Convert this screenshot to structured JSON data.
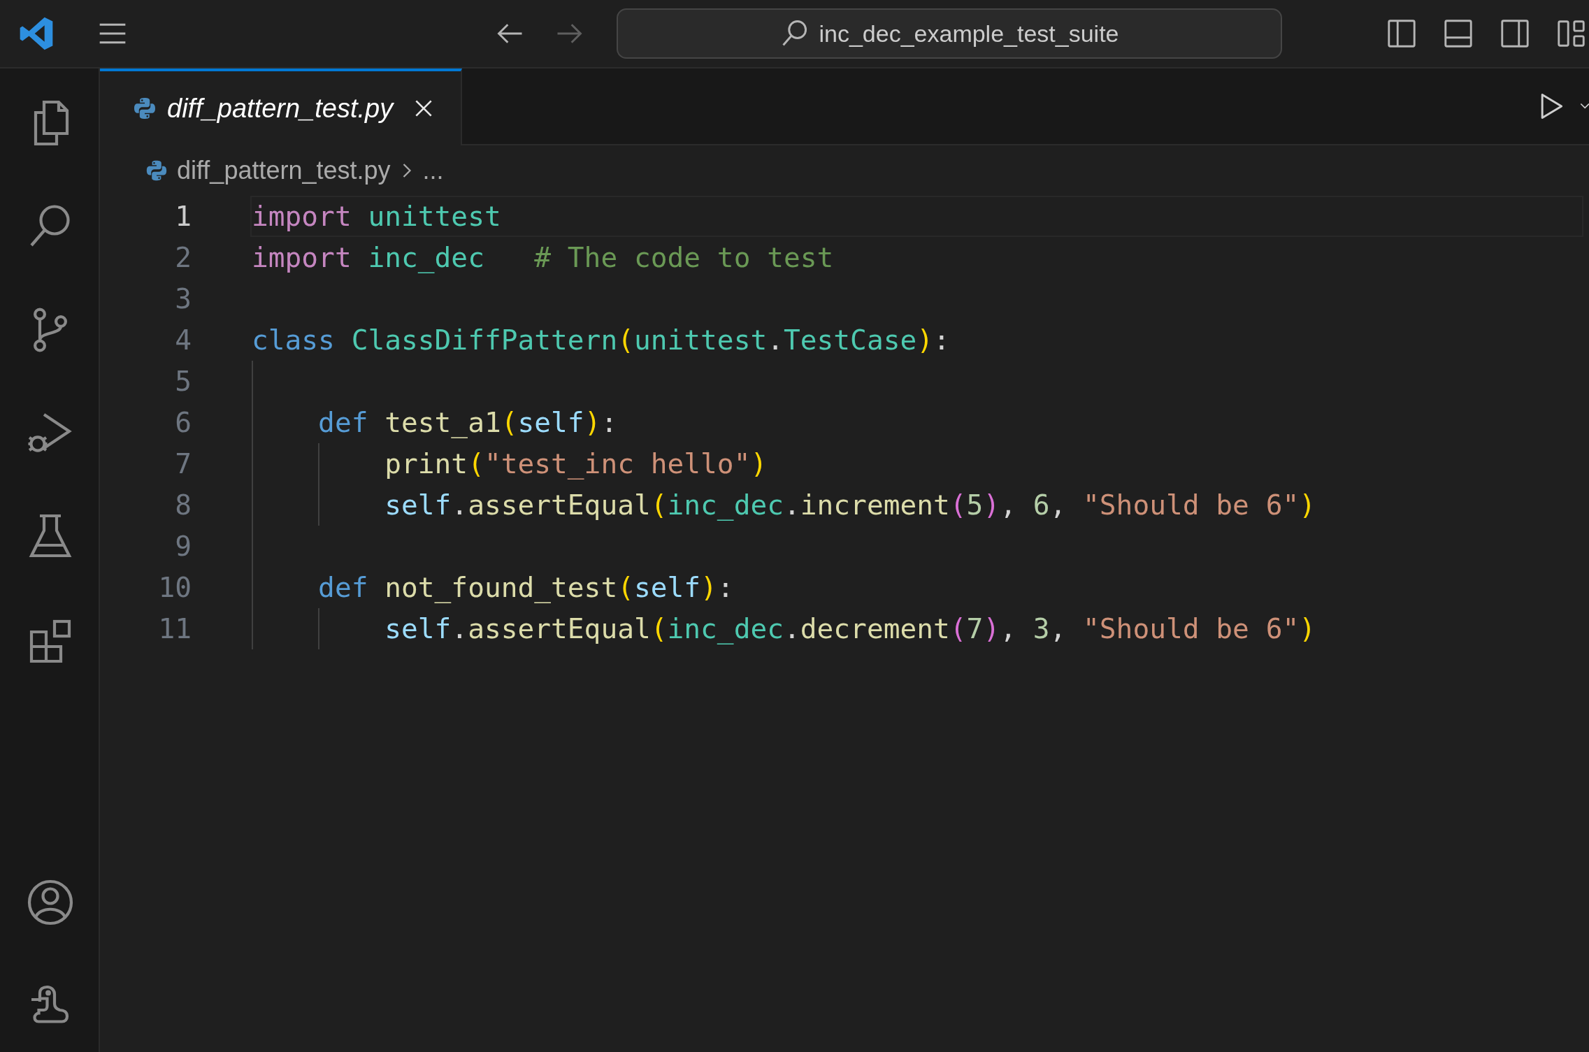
{
  "title_bar": {
    "nav": [
      {
        "kind": "back",
        "disabled": false
      },
      {
        "kind": "forward",
        "disabled": true
      }
    ],
    "command_center": {
      "label": "inc_dec_example_test_suite"
    }
  },
  "activity_bar": {
    "items": [
      {
        "kind": "explorer",
        "selected": false
      },
      {
        "kind": "search",
        "selected": false
      },
      {
        "kind": "source_control",
        "selected": false
      },
      {
        "kind": "run_debug",
        "selected": false
      },
      {
        "kind": "testing",
        "selected": false
      },
      {
        "kind": "extensions",
        "selected": false
      }
    ],
    "bottom_items": [
      {
        "kind": "account"
      },
      {
        "kind": "python_env"
      }
    ]
  },
  "tabs": [
    {
      "label": "diff_pattern_test.py",
      "selected": true,
      "preview": true
    }
  ],
  "breadcrumb": [
    "diff_pattern_test.py",
    "..."
  ],
  "editor": {
    "lines": [
      {
        "number": "1",
        "current": true,
        "tokens": [
          {
            "text": "import",
            "kind": "keyword"
          },
          {
            "text": " unittest",
            "kind": "module"
          }
        ]
      },
      {
        "number": "2",
        "current": false,
        "tokens": [
          {
            "text": "import",
            "kind": "keyword"
          },
          {
            "text": " inc_dec",
            "kind": "module"
          },
          {
            "text": "   # The code to test",
            "kind": "comment"
          }
        ]
      },
      {
        "number": "3",
        "current": false
      },
      {
        "number": "4",
        "current": false,
        "tokens": [
          {
            "text": "class",
            "kind": "storage"
          },
          {
            "text": " ClassDiffPattern",
            "kind": "class"
          },
          {
            "text": "(",
            "kind": "paren1"
          },
          {
            "text": "unittest",
            "kind": "module"
          },
          {
            "text": ".",
            "kind": "plain"
          },
          {
            "text": "TestCase",
            "kind": "class"
          },
          {
            "text": ")",
            "kind": "paren1"
          },
          {
            "text": ":",
            "kind": "plain"
          }
        ]
      },
      {
        "number": "5",
        "current": false
      },
      {
        "number": "6",
        "current": false,
        "tokens": [
          {
            "text": "    def",
            "kind": "storage"
          },
          {
            "text": " test_a1",
            "kind": "func"
          },
          {
            "text": "(",
            "kind": "paren1"
          },
          {
            "text": "self",
            "kind": "param"
          },
          {
            "text": ")",
            "kind": "paren1"
          },
          {
            "text": ":",
            "kind": "plain"
          }
        ]
      },
      {
        "number": "7",
        "current": false,
        "tokens": [
          {
            "text": "        print",
            "kind": "func"
          },
          {
            "text": "(",
            "kind": "paren1"
          },
          {
            "text": "\"test_inc hello\"",
            "kind": "string"
          },
          {
            "text": ")",
            "kind": "paren1"
          }
        ]
      },
      {
        "number": "8",
        "current": false,
        "tokens": [
          {
            "text": "        self",
            "kind": "param"
          },
          {
            "text": ".",
            "kind": "plain"
          },
          {
            "text": "assertEqual",
            "kind": "func"
          },
          {
            "text": "(",
            "kind": "paren1"
          },
          {
            "text": "inc_dec",
            "kind": "module"
          },
          {
            "text": ".",
            "kind": "plain"
          },
          {
            "text": "increment",
            "kind": "func"
          },
          {
            "text": "(",
            "kind": "paren2"
          },
          {
            "text": "5",
            "kind": "number"
          },
          {
            "text": ")",
            "kind": "paren2"
          },
          {
            "text": ", ",
            "kind": "plain"
          },
          {
            "text": "6",
            "kind": "number"
          },
          {
            "text": ", ",
            "kind": "plain"
          },
          {
            "text": "\"Should be 6\"",
            "kind": "string"
          },
          {
            "text": ")",
            "kind": "paren1"
          }
        ]
      },
      {
        "number": "9",
        "current": false
      },
      {
        "number": "10",
        "current": false,
        "tokens": [
          {
            "text": "    def",
            "kind": "storage"
          },
          {
            "text": " not_found_test",
            "kind": "func"
          },
          {
            "text": "(",
            "kind": "paren1"
          },
          {
            "text": "self",
            "kind": "param"
          },
          {
            "text": ")",
            "kind": "paren1"
          },
          {
            "text": ":",
            "kind": "plain"
          }
        ]
      },
      {
        "number": "11",
        "current": false,
        "tokens": [
          {
            "text": "        self",
            "kind": "param"
          },
          {
            "text": ".",
            "kind": "plain"
          },
          {
            "text": "assertEqual",
            "kind": "func"
          },
          {
            "text": "(",
            "kind": "paren1"
          },
          {
            "text": "inc_dec",
            "kind": "module"
          },
          {
            "text": ".",
            "kind": "plain"
          },
          {
            "text": "decrement",
            "kind": "func"
          },
          {
            "text": "(",
            "kind": "paren2"
          },
          {
            "text": "7",
            "kind": "number"
          },
          {
            "text": ")",
            "kind": "paren2"
          },
          {
            "text": ", ",
            "kind": "plain"
          },
          {
            "text": "3",
            "kind": "number"
          },
          {
            "text": ", ",
            "kind": "plain"
          },
          {
            "text": "\"Should be 6\"",
            "kind": "string"
          },
          {
            "text": ")",
            "kind": "paren1"
          }
        ]
      }
    ]
  }
}
